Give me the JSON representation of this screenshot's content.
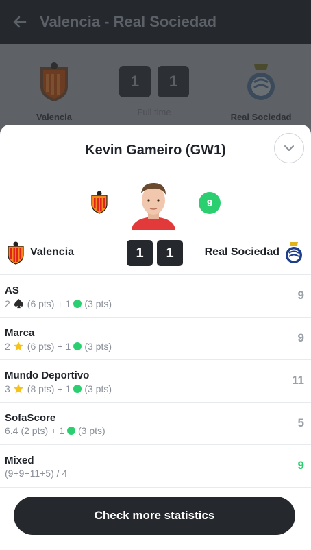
{
  "topbar": {
    "title": "Valencia - Real Sociedad",
    "back_icon": "arrow-left-icon"
  },
  "background_match": {
    "home": "Valencia",
    "away": "Real Sociedad",
    "home_score": "1",
    "away_score": "1",
    "status": "Full time"
  },
  "sheet": {
    "player_title": "Kevin Gameiro (GW1)",
    "collapse_icon": "chevron-down-icon",
    "points": "9",
    "match": {
      "home": "Valencia",
      "home_score": "1",
      "away_score": "1",
      "away": "Real Sociedad"
    },
    "sources": [
      {
        "name": "AS",
        "count": "2",
        "icon": "spade-icon",
        "icon_pts": "(6 pts)",
        "plus": "+ 1",
        "extra_pts": "(3 pts)",
        "score": "9"
      },
      {
        "name": "Marca",
        "count": "2",
        "icon": "star-icon",
        "icon_pts": "(6 pts)",
        "plus": "+ 1",
        "extra_pts": "(3 pts)",
        "score": "9"
      },
      {
        "name": "Mundo Deportivo",
        "count": "3",
        "icon": "star-icon",
        "icon_pts": "(8 pts)",
        "plus": "+ 1",
        "extra_pts": "(3 pts)",
        "score": "11"
      },
      {
        "name": "SofaScore",
        "count": "6.4",
        "icon": "",
        "icon_pts": "(2 pts)",
        "plus": "+ 1",
        "extra_pts": "(3 pts)",
        "score": "5"
      }
    ],
    "mixed": {
      "name": "Mixed",
      "formula": "(9+9+11+5) / 4",
      "score": "9"
    },
    "cta_label": "Check more statistics"
  },
  "colors": {
    "accent_green": "#2bcf70",
    "dark": "#25282d",
    "muted": "#8a9099",
    "star": "#f6c21c"
  }
}
